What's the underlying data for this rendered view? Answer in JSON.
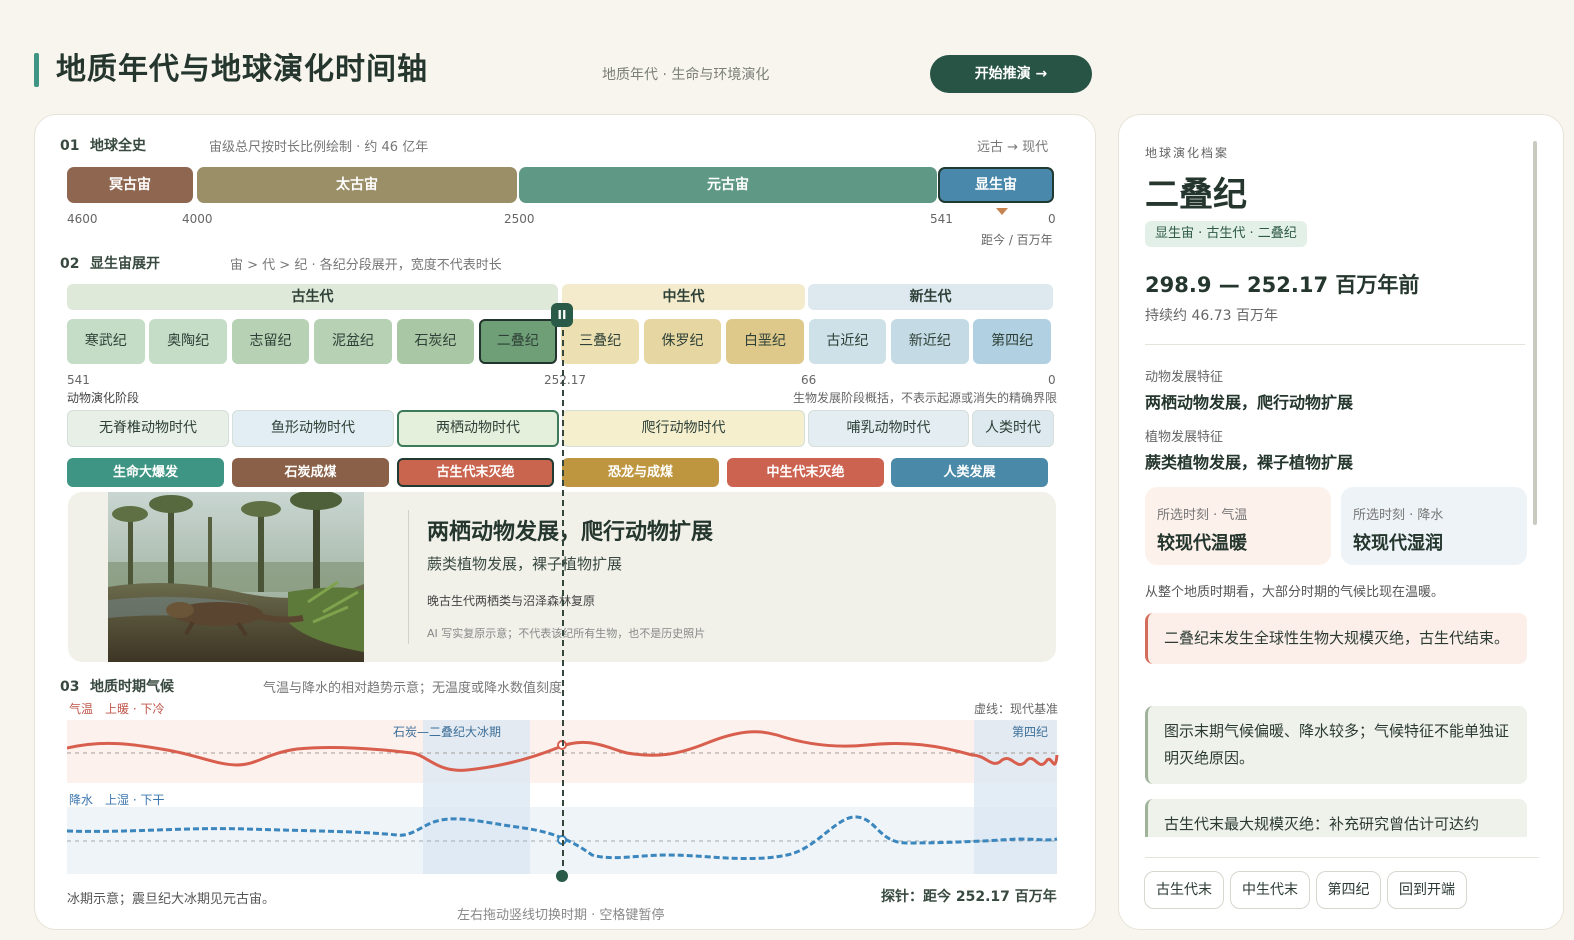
{
  "header": {
    "title": "地质年代与地球演化时间轴",
    "subtitle": "地质年代 · 生命与环境演化",
    "start_button": "开始推演 →"
  },
  "section1": {
    "num": "01",
    "title": "地球全史",
    "note": "宙级总尺按时长比例绘制 · 约 46 亿年",
    "direction": "远古 → 现代",
    "eons": [
      {
        "label": "冥古宙",
        "color": "#8f6650"
      },
      {
        "label": "太古宙",
        "color": "#9a8f66"
      },
      {
        "label": "元古宙",
        "color": "#5f9985"
      },
      {
        "label": "显生宙",
        "color": "#4a88ab",
        "selected": true
      }
    ],
    "ticks": [
      "4600",
      "4000",
      "2500",
      "541",
      "0"
    ],
    "unit": "距今 / 百万年"
  },
  "section2": {
    "num": "02",
    "title": "显生宙展开",
    "note": "宙 > 代 > 纪 · 各纪分段展开，宽度不代表时长",
    "eras": [
      {
        "label": "古生代",
        "color": "#dfe9d9"
      },
      {
        "label": "中生代",
        "color": "#f3ebcb"
      },
      {
        "label": "新生代",
        "color": "#dde9ef"
      }
    ],
    "periods": [
      {
        "label": "寒武纪",
        "color": "#c5dcc6"
      },
      {
        "label": "奥陶纪",
        "color": "#c5dcc6"
      },
      {
        "label": "志留纪",
        "color": "#b7d1b4"
      },
      {
        "label": "泥盆纪",
        "color": "#b7d1b4"
      },
      {
        "label": "石炭纪",
        "color": "#a9c7a4"
      },
      {
        "label": "二叠纪",
        "color": "#6f9f76",
        "selected": true
      },
      {
        "label": "三叠纪",
        "color": "#ece0b3"
      },
      {
        "label": "侏罗纪",
        "color": "#e6d7a2"
      },
      {
        "label": "白垩纪",
        "color": "#dec98a"
      },
      {
        "label": "古近纪",
        "color": "#cfe1e8"
      },
      {
        "label": "新近纪",
        "color": "#c4dbe6"
      },
      {
        "label": "第四纪",
        "color": "#b1d1e2"
      }
    ],
    "ticks": [
      "541",
      "252.17",
      "66",
      "0"
    ],
    "stage_title": "动物演化阶段",
    "stage_note": "生物发展阶段概括，不表示起源或消失的精确界限",
    "stages": [
      {
        "label": "无脊椎动物时代",
        "color": "#e7efe6"
      },
      {
        "label": "鱼形动物时代",
        "color": "#e2eef3"
      },
      {
        "label": "两栖动物时代",
        "color": "#e4efdc",
        "selected": true
      },
      {
        "label": "爬行动物时代",
        "color": "#f5efcd"
      },
      {
        "label": "哺乳动物时代",
        "color": "#e3edf2"
      },
      {
        "label": "人类时代",
        "color": "#dde9ef"
      }
    ],
    "events": [
      {
        "label": "生命大爆发",
        "color": "#3f9583"
      },
      {
        "label": "石炭成煤",
        "color": "#8a6148"
      },
      {
        "label": "古生代末灭绝",
        "color": "#c9644f",
        "selected": true
      },
      {
        "label": "恐龙与成煤",
        "color": "#bf9640"
      },
      {
        "label": "中生代末灭绝",
        "color": "#cc6351"
      },
      {
        "label": "人类发展",
        "color": "#4a8aa8"
      }
    ],
    "detail": {
      "title": "两栖动物发展，爬行动物扩展",
      "subtitle": "蕨类植物发展，裸子植物扩展",
      "caption": "晚古生代两栖类与沼泽森林复原",
      "note": "AI 写实复原示意；不代表该纪所有生物，也不是历史照片"
    },
    "probe_handle": "II"
  },
  "section3": {
    "num": "03",
    "title": "地质时期气候",
    "note": "气温与降水的相对趋势示意；无温度或降水数值刻度",
    "temp_label": "气温　上暖 · 下冷",
    "baseline_label": "虚线：现代基准",
    "precip_label": "降水　上湿 · 下干",
    "icehouse_label": "石炭—二叠纪大冰期",
    "quaternary_label": "第四纪",
    "footnote": "冰期示意；震旦纪大冰期见元古宙。",
    "probe_readout": "探针：距今 252.17 百万年",
    "hint": "左右拖动竖线切换时期 · 空格键暂停",
    "colors": {
      "temp": "#d85f4e",
      "precip": "#3a86bd"
    }
  },
  "side": {
    "kicker": "地球演化档案",
    "title": "二叠纪",
    "path": "显生宙 · 古生代 · 二叠纪",
    "range": "298.9 — 252.17 百万年前",
    "duration": "持续约 46.73 百万年",
    "animal_label": "动物发展特征",
    "animal_value": "两栖动物发展，爬行动物扩展",
    "plant_label": "植物发展特征",
    "plant_value": "蕨类植物发展，裸子植物扩展",
    "temp_key": "所选时刻 · 气温",
    "temp_val": "较现代温暖",
    "precip_key": "所选时刻 · 降水",
    "precip_val": "较现代湿润",
    "climate_note": "从整个地质时期看，大部分时期的气候比现在温暖。",
    "notes": [
      "二叠纪末发生全球性生物大规模灭绝，古生代结束。",
      "图示末期气候偏暖、降水较多；气候特征不能单独证明灭绝原因。",
      "古生代末最大规模灭绝：补充研究曾估计可达约"
    ],
    "quick": [
      "古生代末",
      "中生代末",
      "第四纪",
      "回到开端"
    ]
  }
}
